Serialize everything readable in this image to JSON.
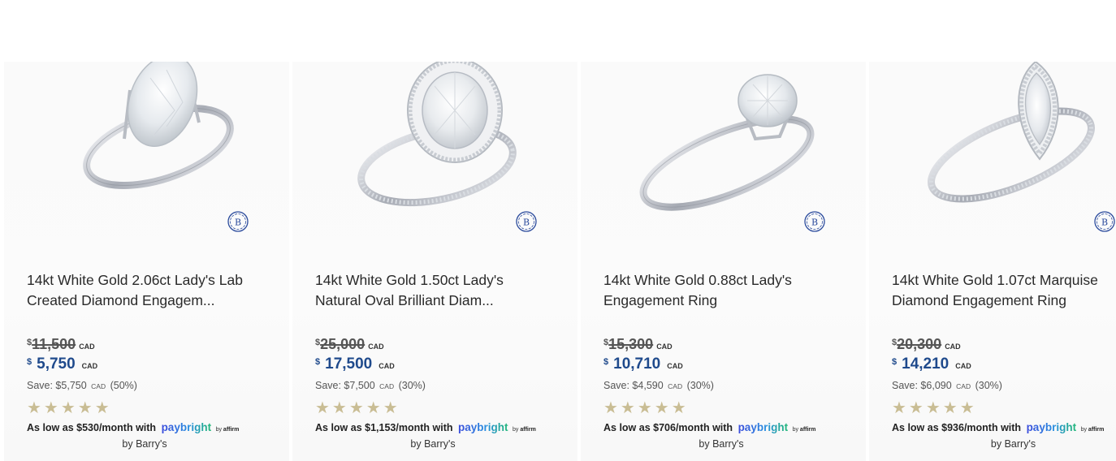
{
  "products": [
    {
      "title_line1": "14kt White Gold 2.06ct Lady's Lab",
      "title_line2": "Created Diamond Engagem...",
      "old_currency": "$",
      "old_price": "11,500",
      "old_code": "CAD",
      "new_currency": "$",
      "new_price": "5,750",
      "new_code": "CAD",
      "save_prefix": "Save: $5,750",
      "save_code": "CAD",
      "save_percent": "(50%)",
      "stars": "★★★★★",
      "rating": 5,
      "finance_text": "As low as $530/month with",
      "paybright_label": "paybright",
      "by_affirm_prefix": "by",
      "affirm_label": "affirm",
      "seller": "by Barry's",
      "ring_style": "oval-solitaire"
    },
    {
      "title_line1": "14kt White Gold 1.50ct Lady's",
      "title_line2": "Natural Oval Brilliant Diam...",
      "old_currency": "$",
      "old_price": "25,000",
      "old_code": "CAD",
      "new_currency": "$",
      "new_price": "17,500",
      "new_code": "CAD",
      "save_prefix": "Save: $7,500",
      "save_code": "CAD",
      "save_percent": "(30%)",
      "stars": "★★★★★",
      "rating": 5,
      "finance_text": "As low as $1,153/month with",
      "paybright_label": "paybright",
      "by_affirm_prefix": "by",
      "affirm_label": "affirm",
      "seller": "by Barry's",
      "ring_style": "oval-halo"
    },
    {
      "title_line1": "14kt White Gold 0.88ct Lady's",
      "title_line2": "Engagement Ring",
      "old_currency": "$",
      "old_price": "15,300",
      "old_code": "CAD",
      "new_currency": "$",
      "new_price": "10,710",
      "new_code": "CAD",
      "save_prefix": "Save: $4,590",
      "save_code": "CAD",
      "save_percent": "(30%)",
      "stars": "★★★★★",
      "rating": 5,
      "finance_text": "As low as $706/month with",
      "paybright_label": "paybright",
      "by_affirm_prefix": "by",
      "affirm_label": "affirm",
      "seller": "by Barry's",
      "ring_style": "round-solitaire"
    },
    {
      "title_line1": "14kt White Gold 1.07ct Marquise",
      "title_line2": "Diamond Engagement Ring",
      "old_currency": "$",
      "old_price": "20,300",
      "old_code": "CAD",
      "new_currency": "$",
      "new_price": "14,210",
      "new_code": "CAD",
      "save_prefix": "Save: $6,090",
      "save_code": "CAD",
      "save_percent": "(30%)",
      "stars": "★★★★★",
      "rating": 5,
      "finance_text": "As low as $936/month with",
      "paybright_label": "paybright",
      "by_affirm_prefix": "by",
      "affirm_label": "affirm",
      "seller": "by Barry's",
      "ring_style": "marquise-halo"
    }
  ],
  "brand_badge_letter": "B",
  "colors": {
    "price_blue": "#1f4a8c",
    "star_gold": "#c9bd94",
    "badge_blue": "#2a4a9c"
  }
}
